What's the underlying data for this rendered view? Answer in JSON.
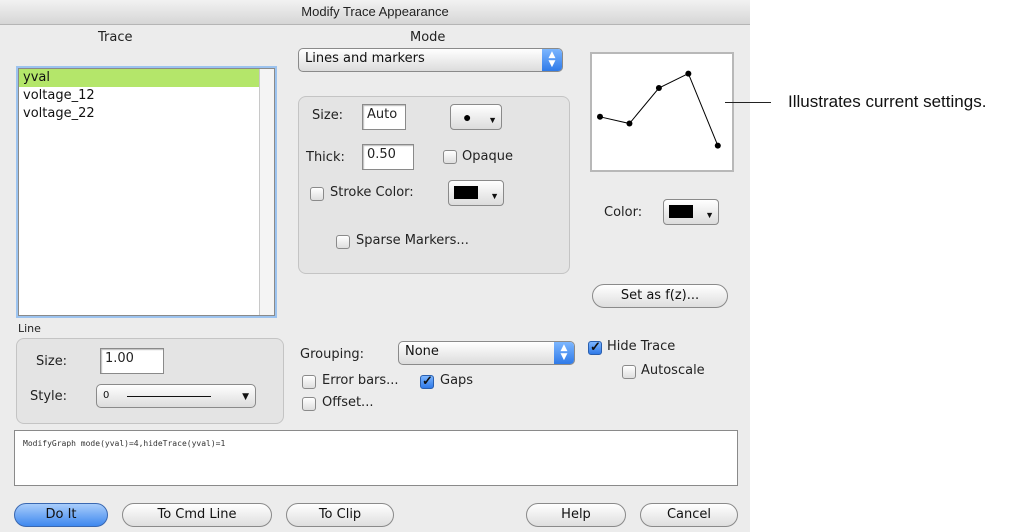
{
  "window": {
    "title": "Modify Trace Appearance"
  },
  "trace": {
    "header": "Trace",
    "items": [
      "yval",
      "voltage_12",
      "voltage_22"
    ],
    "selected_index": 0
  },
  "mode": {
    "header": "Mode",
    "selected": "Lines and markers",
    "size_label": "Size:",
    "size_value": "Auto",
    "thick_label": "Thick:",
    "thick_value": "0.50",
    "opaque_label": "Opaque",
    "opaque_checked": false,
    "stroke_color_label": "Stroke Color:",
    "stroke_color_checked": false,
    "sparse_markers_label": "Sparse Markers...",
    "sparse_markers_checked": false,
    "marker_icon": "filled-circle-marker"
  },
  "preview": {
    "points": [
      [
        0,
        0.45
      ],
      [
        1,
        0.38
      ],
      [
        2,
        0.75
      ],
      [
        3,
        0.9
      ],
      [
        4,
        0.15
      ]
    ]
  },
  "color": {
    "label": "Color:",
    "value": "#000000"
  },
  "set_as_fz_label": "Set as f(z)...",
  "line": {
    "header": "Line",
    "size_label": "Size:",
    "size_value": "1.00",
    "style_label": "Style:",
    "style_value": "0"
  },
  "grouping": {
    "label": "Grouping:",
    "selected": "None"
  },
  "error_bars": {
    "label": "Error bars...",
    "checked": false
  },
  "gaps": {
    "label": "Gaps",
    "checked": true
  },
  "offset": {
    "label": "Offset...",
    "checked": false
  },
  "hide_trace": {
    "label": "Hide Trace",
    "checked": true
  },
  "autoscale": {
    "label": "Autoscale",
    "checked": false
  },
  "command_line": "ModifyGraph mode(yval)=4,hideTrace(yval)=1",
  "buttons": {
    "do_it": "Do It",
    "to_cmd_line": "To Cmd Line",
    "to_clip": "To Clip",
    "help": "Help",
    "cancel": "Cancel"
  },
  "annotation": "Illustrates current settings."
}
